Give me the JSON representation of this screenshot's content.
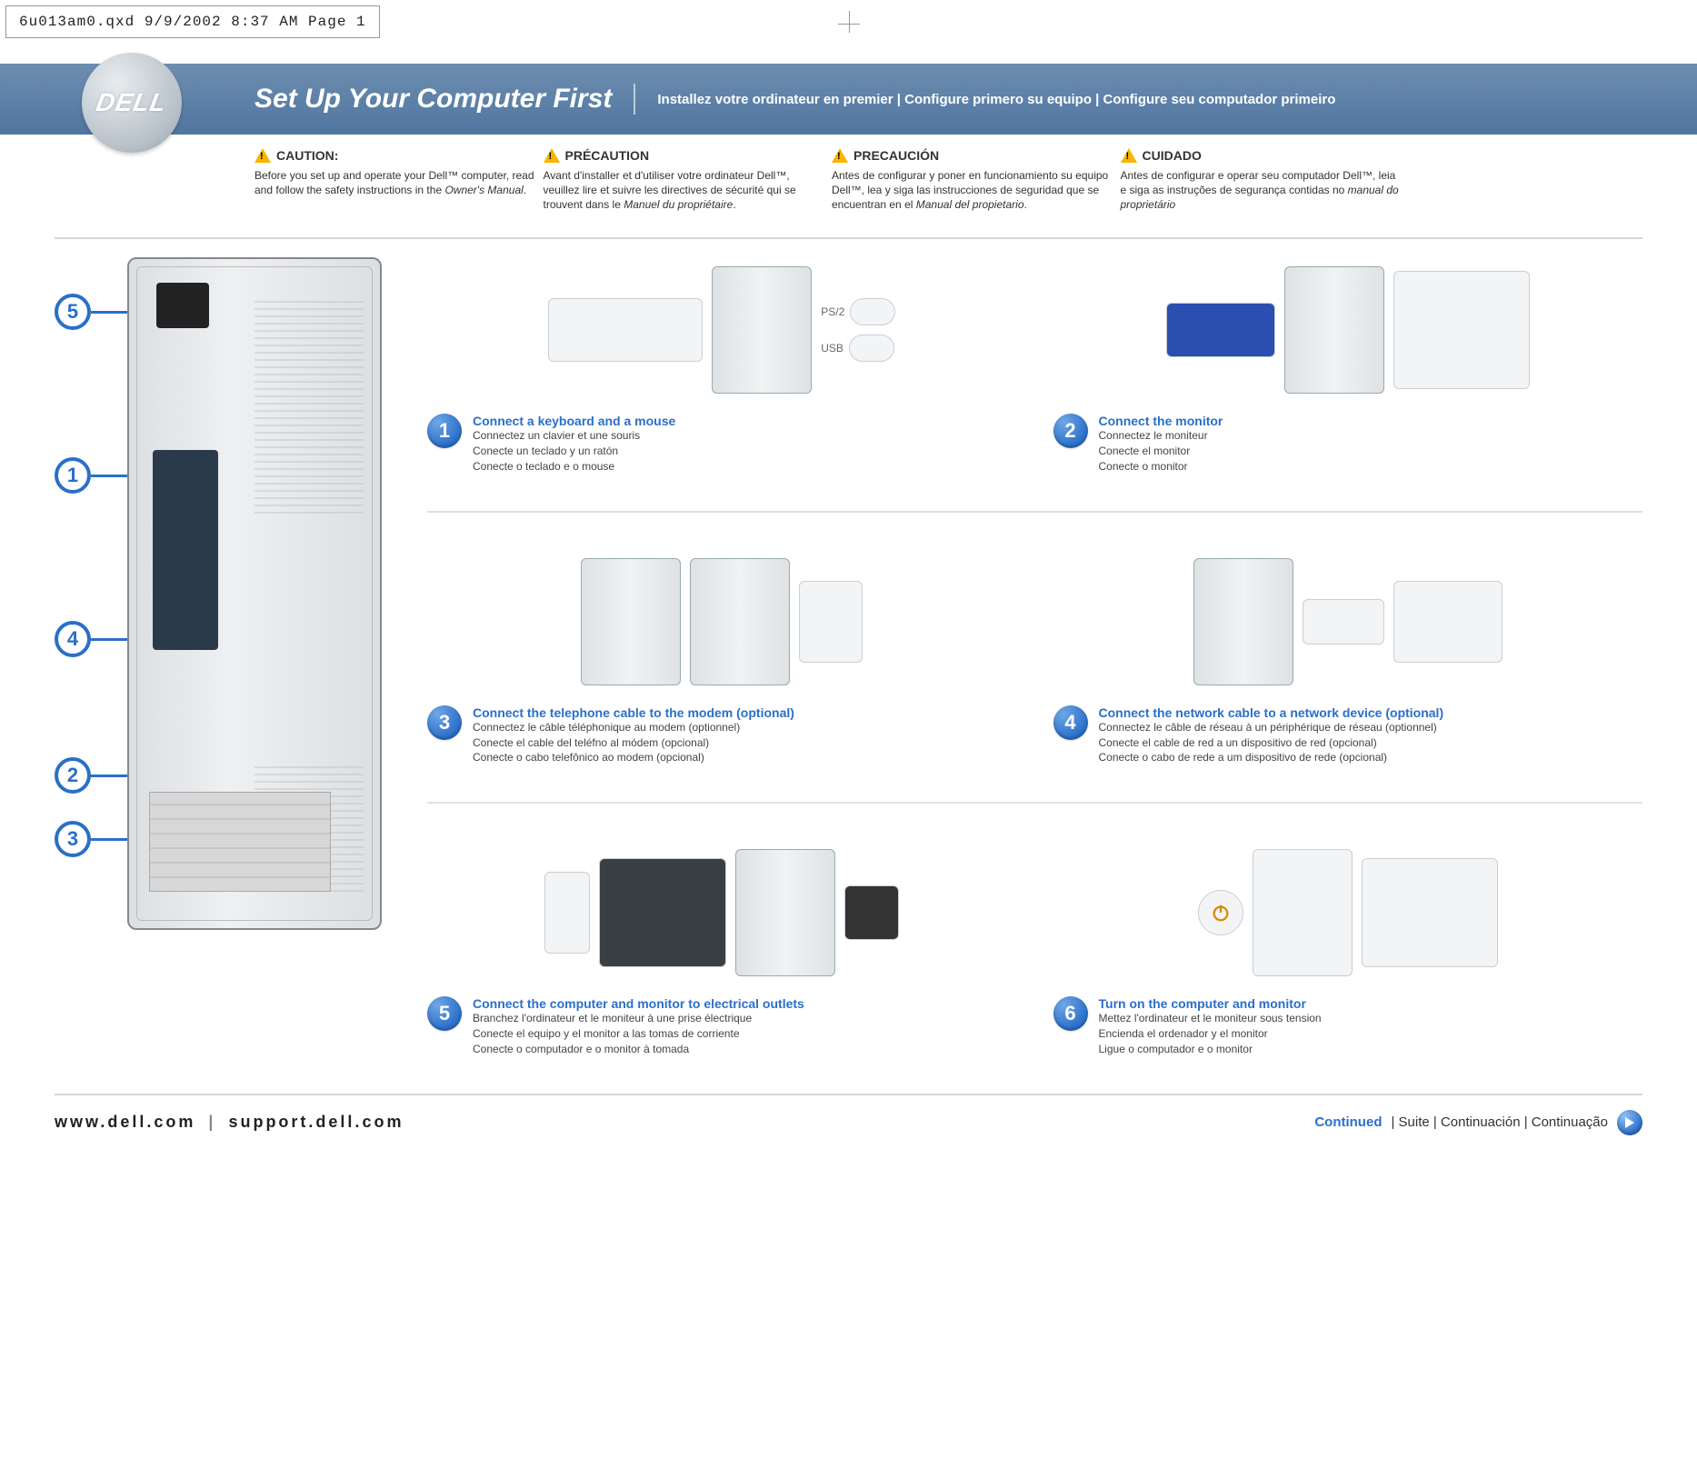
{
  "slug": "6u013am0.qxd  9/9/2002  8:37 AM  Page 1",
  "logo_text": "DELL",
  "banner": {
    "title": "Set Up Your Computer First",
    "subtitle": "Installez votre ordinateur en premier | Configure primero su equipo | Configure seu computador primeiro"
  },
  "cautions": [
    {
      "heading": "CAUTION:",
      "body_prefix": "Before you set up and operate your Dell™ computer, read and follow the safety instructions in the ",
      "body_italic": "Owner's Manual",
      "body_suffix": "."
    },
    {
      "heading": "PRÉCAUTION",
      "body_prefix": "Avant d'installer et d'utiliser votre ordinateur Dell™, veuillez lire et suivre les directives de sécurité qui se trouvent dans le ",
      "body_italic": "Manuel du propriétaire",
      "body_suffix": "."
    },
    {
      "heading": "PRECAUCIÓN",
      "body_prefix": "Antes de configurar y poner en funcionamiento su equipo Dell™, lea y siga las instrucciones de seguridad que se encuentran en el ",
      "body_italic": "Manual del propietario",
      "body_suffix": "."
    },
    {
      "heading": "CUIDADO",
      "body_prefix": "Antes de configurar e operar seu computador Dell™, leia e siga as instruções de segurança contidas no ",
      "body_italic": "manual do proprietário",
      "body_suffix": ""
    }
  ],
  "tower_callouts": [
    "5",
    "1",
    "4",
    "2",
    "3"
  ],
  "port_labels": {
    "ps2": "PS/2",
    "usb": "USB"
  },
  "steps": [
    {
      "num": "1",
      "title": "Connect a keyboard and a mouse",
      "lines": [
        "Connectez un clavier et une souris",
        "Conecte un teclado y un ratón",
        "Conecte o teclado e o mouse"
      ]
    },
    {
      "num": "2",
      "title": "Connect the monitor",
      "lines": [
        "Connectez le moniteur",
        "Conecte el monitor",
        "Conecte o monitor"
      ]
    },
    {
      "num": "3",
      "title": "Connect the telephone cable to the modem (optional)",
      "lines": [
        "Connectez le câble téléphonique au modem (optionnel)",
        "Conecte el cable del teléfno al módem (opcional)",
        "Conecte o cabo telefônico ao modem (opcional)"
      ]
    },
    {
      "num": "4",
      "title": "Connect the network cable to a network device (optional)",
      "lines": [
        "Connectez le câble de réseau à un périphérique de réseau (optionnel)",
        "Conecte el cable de red a un dispositivo de red (opcional)",
        "Conecte o cabo de rede a um dispositivo de rede (opcional)"
      ]
    },
    {
      "num": "5",
      "title": "Connect the computer and monitor to electrical outlets",
      "lines": [
        "Branchez l'ordinateur et le moniteur à une prise électrique",
        "Conecte el equipo y el monitor a las tomas de corriente",
        "Conecte o computador e o monitor à tomada"
      ]
    },
    {
      "num": "6",
      "title": "Turn on the computer and monitor",
      "lines": [
        "Mettez l'ordinateur et le moniteur sous tension",
        "Encienda el ordenador y el monitor",
        "Ligue o computador e o monitor"
      ]
    }
  ],
  "footer": {
    "url1": "www.dell.com",
    "sep": "|",
    "url2": "support.dell.com",
    "continued": "Continued",
    "continued_rest": " | Suite | Continuación | Continuação"
  }
}
